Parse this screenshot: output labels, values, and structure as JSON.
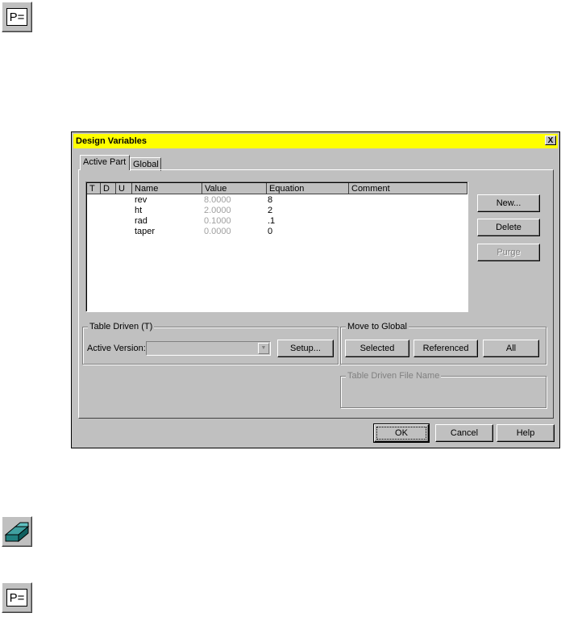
{
  "icons": {
    "top_icon": "pe-equals-icon",
    "extrude_icon": "extrude-block-icon",
    "bottom_icon": "pe-equals-icon",
    "pe_glyph_text": "P="
  },
  "dialog": {
    "title": "Design Variables",
    "close_label": "X",
    "title_color": "#ffff00",
    "tabs": [
      {
        "label": "Active Part",
        "active": true
      },
      {
        "label": "Global",
        "active": false
      }
    ],
    "columns": [
      "T",
      "D",
      "U",
      "Name",
      "Value",
      "Equation",
      "Comment"
    ],
    "rows": [
      {
        "name": "rev",
        "value": "8.0000",
        "equation": "8",
        "comment": ""
      },
      {
        "name": "ht",
        "value": "2.0000",
        "equation": "2",
        "comment": ""
      },
      {
        "name": "rad",
        "value": "0.1000",
        "equation": ".1",
        "comment": ""
      },
      {
        "name": "taper",
        "value": "0.0000",
        "equation": "0",
        "comment": ""
      }
    ],
    "side_buttons": {
      "new": "New...",
      "delete": "Delete",
      "purge": "Purge"
    },
    "table_driven": {
      "label": "Table Driven (T)",
      "active_version_label": "Active Version:",
      "active_version_value": "",
      "setup_button": "Setup..."
    },
    "move_to_global": {
      "label": "Move to Global",
      "selected_button": "Selected",
      "referenced_button": "Referenced",
      "all_button": "All"
    },
    "table_driven_file": {
      "label": "Table Driven File Name",
      "value": ""
    },
    "footer_buttons": {
      "ok": "OK",
      "cancel": "Cancel",
      "help": "Help"
    }
  }
}
